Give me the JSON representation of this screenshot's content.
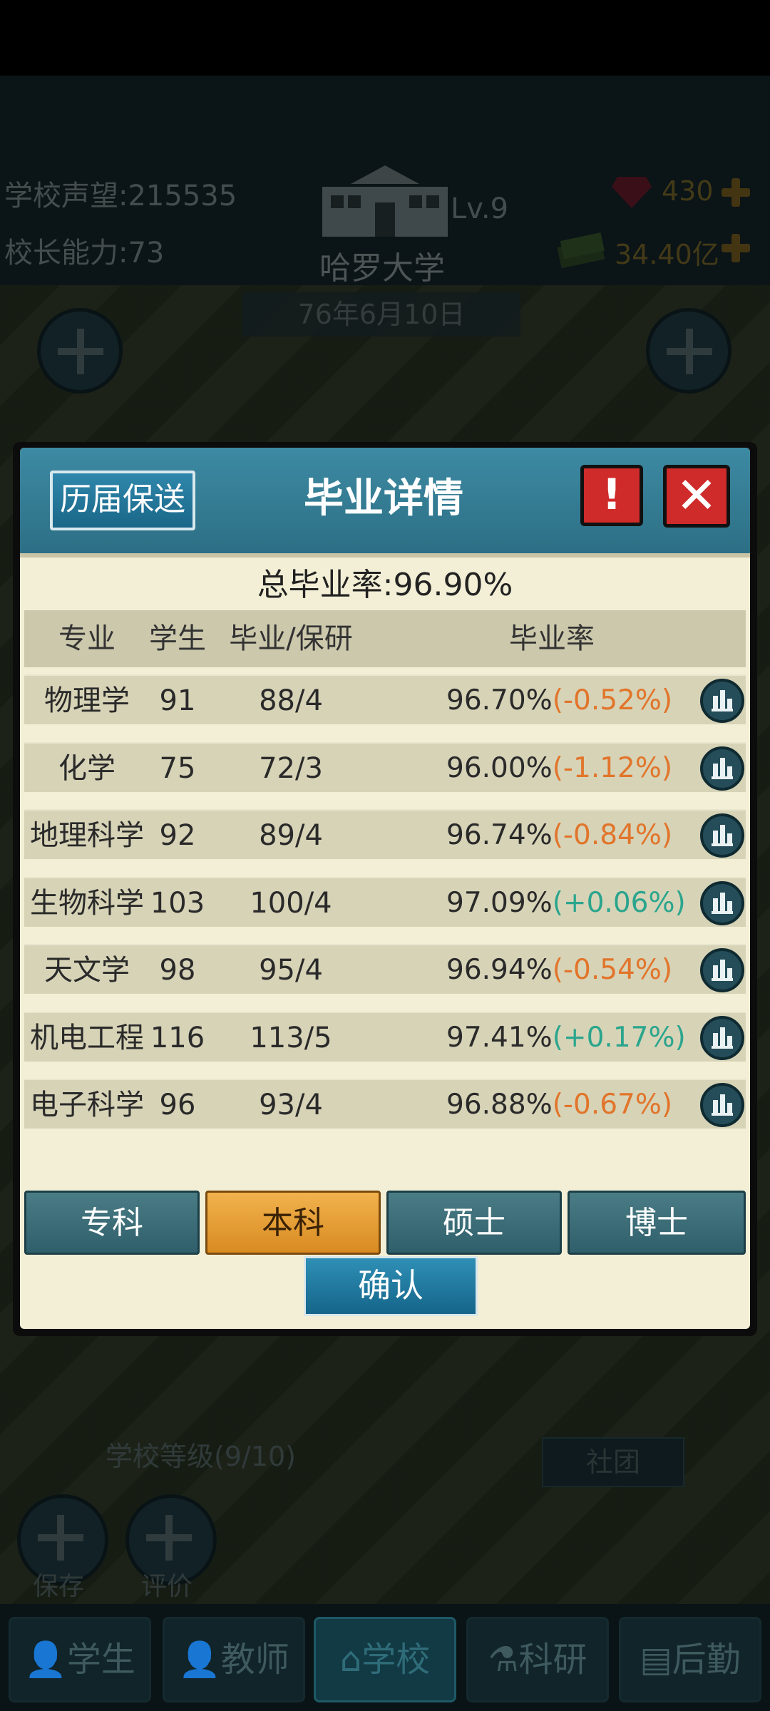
{
  "hud": {
    "reputation_label": "学校声望:",
    "reputation_value": "215535",
    "principal_label": "校长能力:",
    "principal_value": "73",
    "level": "Lv.9",
    "school_name": "哈罗大学",
    "gems": "430",
    "money": "34.40亿",
    "date": "76年6月10日"
  },
  "background": {
    "school_grade": "学校等级(9/10)",
    "club": "社团",
    "save": "保存",
    "review": "评价"
  },
  "bottom_nav": [
    {
      "label": "学生",
      "icon": "student-icon"
    },
    {
      "label": "教师",
      "icon": "teacher-icon"
    },
    {
      "label": "学校",
      "icon": "school-icon",
      "active": true
    },
    {
      "label": "科研",
      "icon": "flask-icon"
    },
    {
      "label": "后勤",
      "icon": "clipboard-icon"
    }
  ],
  "dialog": {
    "history_button": "历届保送",
    "title": "毕业详情",
    "warn_symbol": "!",
    "close_symbol": "✕",
    "total_rate_label": "总毕业率:",
    "total_rate_value": "96.90%",
    "columns": [
      "专业",
      "学生",
      "毕业/保研",
      "毕业率"
    ],
    "rows": [
      {
        "major": "物理学",
        "students": "91",
        "grad_recommend": "88/4",
        "rate": "96.70%",
        "change": "(-0.52%)",
        "trend": "neg"
      },
      {
        "major": "化学",
        "students": "75",
        "grad_recommend": "72/3",
        "rate": "96.00%",
        "change": "(-1.12%)",
        "trend": "neg"
      },
      {
        "major": "地理科学",
        "students": "92",
        "grad_recommend": "89/4",
        "rate": "96.74%",
        "change": "(-0.84%)",
        "trend": "neg"
      },
      {
        "major": "生物科学",
        "students": "103",
        "grad_recommend": "100/4",
        "rate": "97.09%",
        "change": "(+0.06%)",
        "trend": "pos"
      },
      {
        "major": "天文学",
        "students": "98",
        "grad_recommend": "95/4",
        "rate": "96.94%",
        "change": "(-0.54%)",
        "trend": "neg"
      },
      {
        "major": "机电工程",
        "students": "116",
        "grad_recommend": "113/5",
        "rate": "97.41%",
        "change": "(+0.17%)",
        "trend": "pos"
      },
      {
        "major": "电子科学",
        "students": "96",
        "grad_recommend": "93/4",
        "rate": "96.88%",
        "change": "(-0.67%)",
        "trend": "neg"
      }
    ],
    "degree_tabs": [
      "专科",
      "本科",
      "硕士",
      "博士"
    ],
    "active_tab": "本科",
    "confirm": "确认"
  },
  "colors": {
    "negative": "#e1752b",
    "positive": "#2ba58d",
    "active_tab": "#e9a33a",
    "header": "#2c6f85"
  }
}
